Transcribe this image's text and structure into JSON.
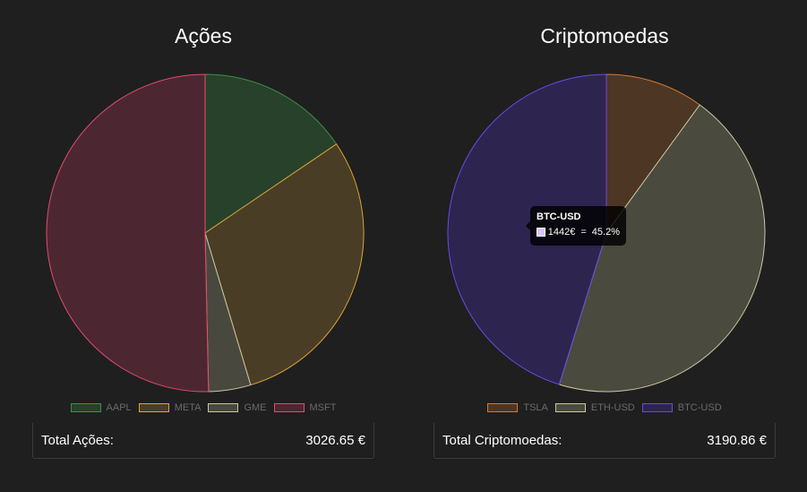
{
  "chart_data": [
    {
      "type": "pie",
      "title": "Ações",
      "categories": [
        "AAPL",
        "META",
        "GME",
        "MSFT"
      ],
      "values": [
        470,
        903,
        130,
        1523.65
      ],
      "colors": {
        "AAPL": {
          "fill": "#28412a",
          "stroke": "#3e8f45"
        },
        "META": {
          "fill": "#4a3d25",
          "stroke": "#d9a43a"
        },
        "GME": {
          "fill": "#49483e",
          "stroke": "#c8c8a0"
        },
        "MSFT": {
          "fill": "#4c2732",
          "stroke": "#e04b6a"
        }
      },
      "legend_position": "bottom",
      "total_label": "Total Ações:",
      "total_value": "3026.65 €"
    },
    {
      "type": "pie",
      "title": "Criptomoedas",
      "categories": [
        "TSLA",
        "ETH-USD",
        "BTC-USD"
      ],
      "values": [
        320,
        1428.86,
        1442
      ],
      "colors": {
        "TSLA": {
          "fill": "#4d3624",
          "stroke": "#d07a35"
        },
        "ETH-USD": {
          "fill": "#4a4a3e",
          "stroke": "#c8c8a0"
        },
        "BTC-USD": {
          "fill": "#2e2450",
          "stroke": "#6a4ae0"
        }
      },
      "legend_position": "bottom",
      "total_label": "Total Criptomoedas:",
      "total_value": "3190.86 €",
      "tooltip": {
        "title": "BTC-USD",
        "value_text": "1442€",
        "separator": "=",
        "percent_text": "45.2%"
      }
    }
  ]
}
